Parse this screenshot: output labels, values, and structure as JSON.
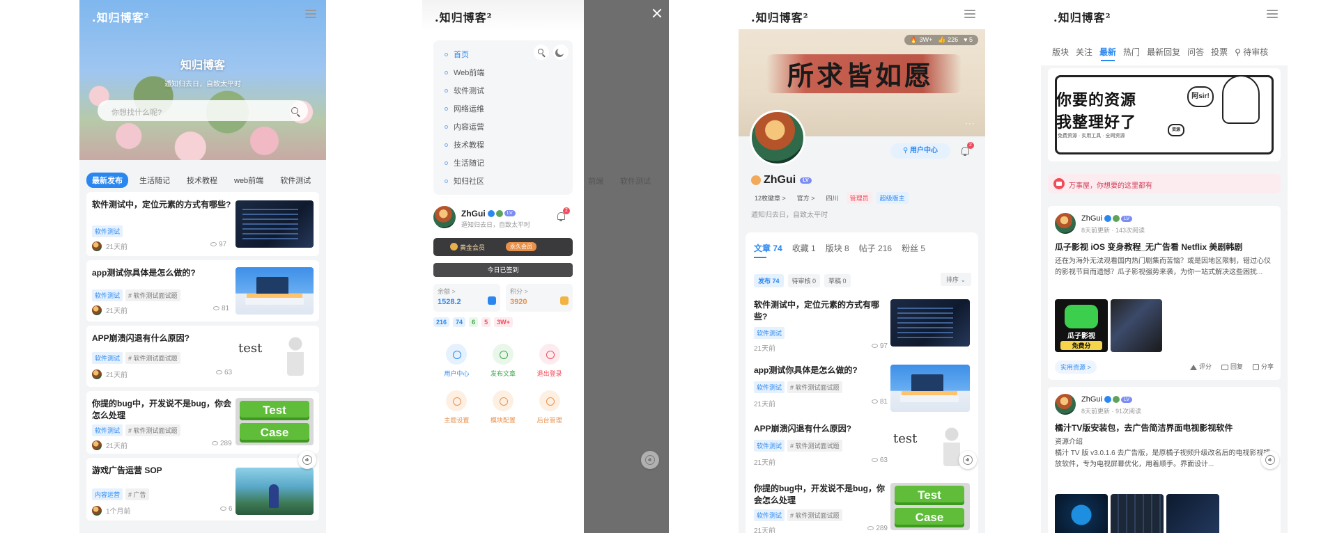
{
  "site": {
    "logo": ".知归博客²",
    "title": "知归博客",
    "slogan": "遁知归去日，自致太平时",
    "search_placeholder": "你想找什么呢?"
  },
  "categories": [
    "最新发布",
    "生活随记",
    "技术教程",
    "web前端",
    "软件测试"
  ],
  "posts": [
    {
      "title": "软件测试中，定位元素的方式有哪些?",
      "tags": [
        "软件测试"
      ],
      "time": "21天前",
      "views": "97"
    },
    {
      "title": "app测试你具体是怎么做的?",
      "tags": [
        "软件测试",
        "# 软件测试面试题"
      ],
      "time": "21天前",
      "views": "81"
    },
    {
      "title": "APP崩溃闪退有什么原因?",
      "tags": [
        "软件测试",
        "# 软件测试面试题"
      ],
      "time": "21天前",
      "views": "63"
    },
    {
      "title": "你提的bug中，开发说不是bug，你会怎么处理",
      "tags": [
        "软件测试",
        "# 软件测试面试题"
      ],
      "time": "21天前",
      "views": "289"
    },
    {
      "title": "游戏广告运营 SOP",
      "tags": [
        "内容运营",
        "# 广告"
      ],
      "time": "1个月前",
      "views": "6"
    }
  ],
  "thumb_text": {
    "test": "test",
    "key1": "Test",
    "key2": "Case"
  },
  "drawer": {
    "menu": [
      "首页",
      "Web前端",
      "软件测试",
      "网络运维",
      "内容运营",
      "技术教程",
      "生活随记",
      "知归社区"
    ],
    "user_name": "ZhGui",
    "user_sig": "遁知归去日，自致太平时",
    "level": "LV",
    "notify_count": "2",
    "vip_label": "黄金会员",
    "vip_tag": "永久会员",
    "sign_label": "今日已签到",
    "balance_label": "余额 >",
    "balance": "1528.2",
    "points_label": "积分 >",
    "points": "3920",
    "counts": [
      "216",
      "74",
      "6",
      "5",
      "3W+"
    ],
    "grid": [
      "用户中心",
      "发布文章",
      "退出登录",
      "主题设置",
      "模块配置",
      "后台管理"
    ],
    "dim_tabs": [
      "前端",
      "软件测试"
    ]
  },
  "profile": {
    "hot": "3W+",
    "likes": "226",
    "hearts": "5",
    "calligraphy": "所求皆如愿",
    "more": "···",
    "user_center": "用户中心",
    "name": "ZhGui",
    "medals": "12枚徽章 >",
    "official": "官方 >",
    "region": "四川",
    "role_admin": "管理员",
    "role_mod": "超级版主",
    "sig": "遁知归去日，自致太平时",
    "tabs": [
      "文章 74",
      "收藏 1",
      "版块 8",
      "帖子 216",
      "粉丝 5"
    ],
    "sub_tabs": [
      "发布 74",
      "待审核 0",
      "草稿 0"
    ],
    "sort": "排序 ⌄"
  },
  "forum": {
    "tabs": [
      "版块",
      "关注",
      "最新",
      "热门",
      "最新回复",
      "问答",
      "投票",
      "待审核"
    ],
    "banner_line1": "你要的资源",
    "banner_line2": "我整理好了",
    "banner_small": "免费资源 · 实用工具 · 全网资源",
    "banner_bubble": "阿sir!",
    "banner_badge": "资源",
    "notice": "万事屋，你想要的这里都有",
    "posts": [
      {
        "user": "ZhGui",
        "meta": "8天前更新 · 143次阅读",
        "title": "瓜子影视 iOS 变身教程_无广告看 Netflix 美剧韩剧",
        "desc": "还在为海外无法观看国内热门剧集而苦恼？或是因地区限制，错过心仪的影视节目而遗憾？瓜子影视强势来袭，为你一站式解决这些困扰...",
        "img_text": "瓜子影视",
        "img_sub": "免费分",
        "resource": "实用资源 >",
        "actions": [
          "评分",
          "回复",
          "分享"
        ]
      },
      {
        "user": "ZhGui",
        "meta": "8天前更新 · 91次阅读",
        "title": "橘汁TV版安装包，去广告简洁界面电视影视软件",
        "desc1": "资源介绍",
        "desc": "橘汁 TV 版 v3.0.1.6 去广告版，是原橘子视频升级改名后的电视影视播放软件，专为电视屏幕优化，用着顺手。界面设计..."
      }
    ]
  },
  "colors": {
    "accent": "#2b87f0",
    "danger": "#f04b5a",
    "gold": "#e8914b"
  }
}
